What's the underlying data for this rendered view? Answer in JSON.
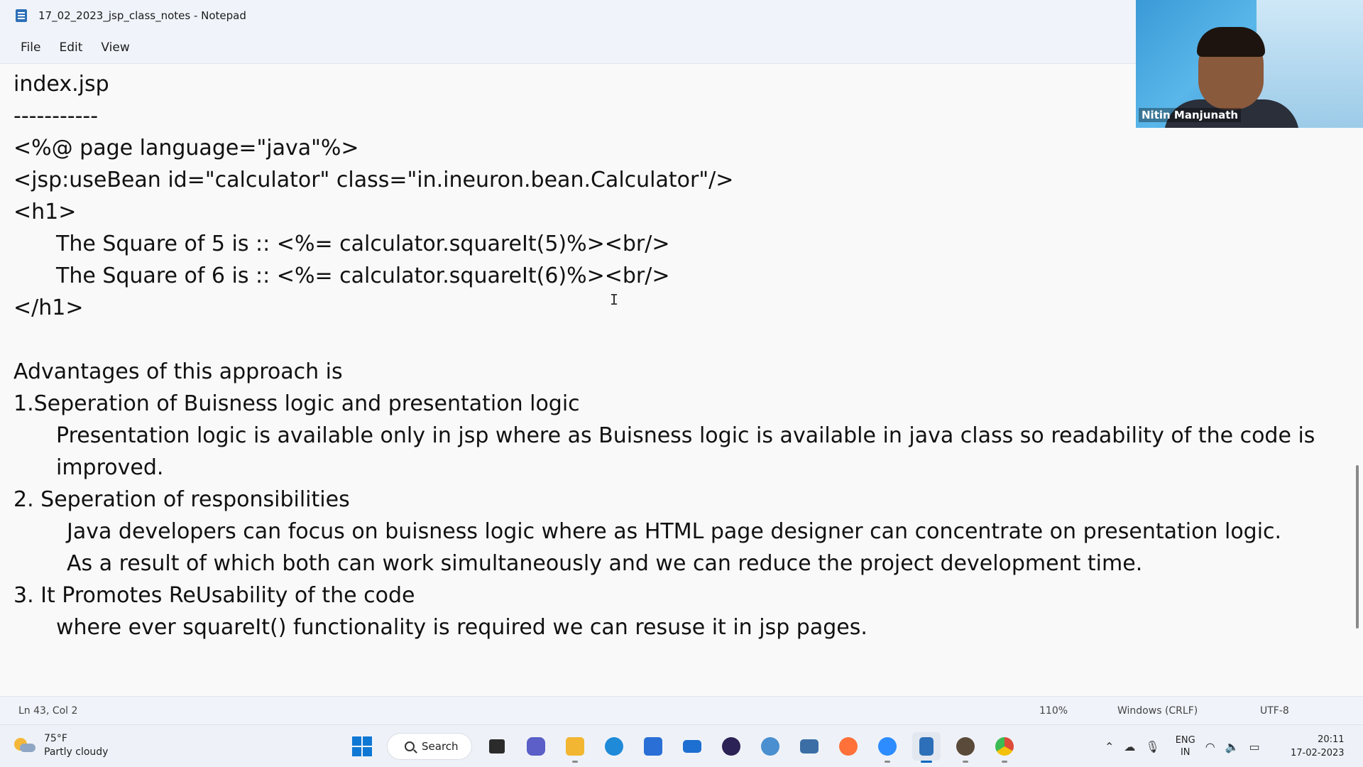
{
  "window": {
    "title": "17_02_2023_jsp_class_notes - Notepad"
  },
  "menu": {
    "items": [
      {
        "label": "File"
      },
      {
        "label": "Edit"
      },
      {
        "label": "View"
      }
    ]
  },
  "editor": {
    "lines": [
      "index.jsp",
      "-----------",
      "<%@ page language=\"java\"%>",
      "<jsp:useBean id=\"calculator\" class=\"in.ineuron.bean.Calculator\"/>",
      "<h1>",
      "The Square of 5 is :: <%= calculator.squareIt(5)%><br/>",
      "The Square of 6 is :: <%= calculator.squareIt(6)%><br/>",
      "</h1>",
      "Advantages of this approach is",
      "1.Seperation of Buisness logic and presentation logic",
      "Presentation logic is available only in jsp where as Buisness logic is available in java class so readability of the code is",
      "improved.",
      "2. Seperation of responsibilities",
      "Java developers can focus on buisness logic where as HTML page designer can concentrate on presentation logic.",
      "As a result of which both can work simultaneously and we can reduce the project development time.",
      "3. It Promotes ReUsability of the code",
      "where ever squareIt() functionality is required we can resuse it in jsp pages."
    ]
  },
  "webcam": {
    "participant_name": "Nitin Manjunath"
  },
  "status": {
    "position": "Ln 43, Col 2",
    "zoom": "110%",
    "line_ending": "Windows (CRLF)",
    "encoding": "UTF-8"
  },
  "taskbar": {
    "weather": {
      "temp": "75°F",
      "condition": "Partly cloudy"
    },
    "search_label": "Search",
    "apps": [
      {
        "icon": "windows-start-icon"
      },
      {
        "icon": "search"
      },
      {
        "icon": "task-view-icon"
      },
      {
        "icon": "chat-icon",
        "color": "#5b5fc7"
      },
      {
        "icon": "file-explorer-icon",
        "color": "#f2b632"
      },
      {
        "icon": "edge-icon",
        "color": "#1f8ad8"
      },
      {
        "icon": "store-icon",
        "color": "#2a6fd6"
      },
      {
        "icon": "mail-icon",
        "color": "#1d6fd0"
      },
      {
        "icon": "eclipse-icon",
        "color": "#2c2255"
      },
      {
        "icon": "java-tool-icon",
        "color": "#4a8fcf"
      },
      {
        "icon": "remote-desktop-icon",
        "color": "#3b6ea5"
      },
      {
        "icon": "firefox-icon",
        "color": "#ff7139"
      },
      {
        "icon": "zoom-icon",
        "color": "#2d8cff"
      },
      {
        "icon": "notepad-icon",
        "color": "#2d6fb8"
      },
      {
        "icon": "game-icon",
        "color": "#5a4a3a"
      },
      {
        "icon": "chrome-icon",
        "color": "#dd4b39"
      }
    ],
    "tray": {
      "lang_top": "ENG",
      "lang_bottom": "IN",
      "time": "20:11",
      "date": "17-02-2023"
    }
  }
}
